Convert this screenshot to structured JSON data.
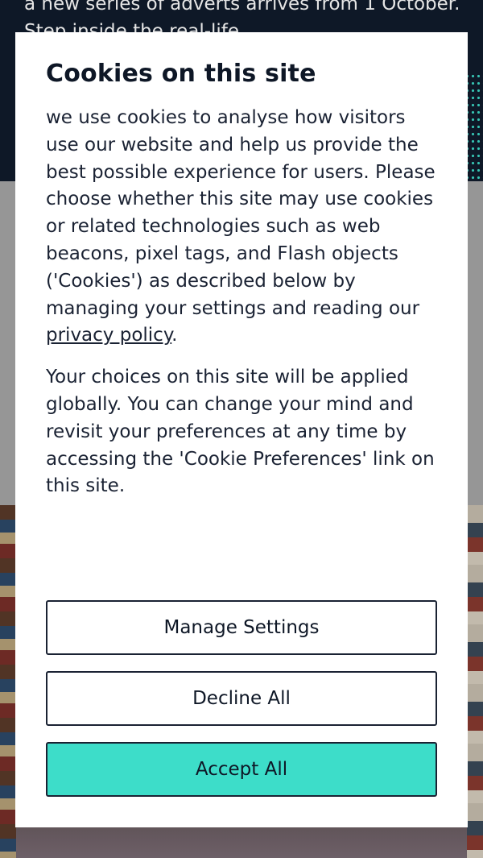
{
  "background": {
    "hero_text": "a new series of adverts arrives from 1 October. Step inside the real-life",
    "colors": {
      "hero": "#101b2c",
      "accent_dots": "#3ddbc8",
      "band": "#a8a8a8"
    }
  },
  "cookie_modal": {
    "title": "Cookies on this site",
    "paragraph_1_prefix": "we use cookies to analyse how visitors use our website and help us provide the best possible experience for users. Please choose whether this site may use cookies or related technologies such as web beacons, pixel tags, and Flash objects ('Cookies') as described below by managing your settings and reading our ",
    "privacy_link": "privacy policy",
    "paragraph_1_suffix": ".",
    "paragraph_2": "Your choices on this site will be applied globally. You can change your mind and revisit your preferences at any time by accessing the 'Cookie Preferences' link on this site.",
    "buttons": {
      "manage": "Manage Settings",
      "decline": "Decline All",
      "accept": "Accept All"
    },
    "colors": {
      "accept_bg": "#3dddc9",
      "text": "#1a2233",
      "border": "#1a2233"
    }
  }
}
